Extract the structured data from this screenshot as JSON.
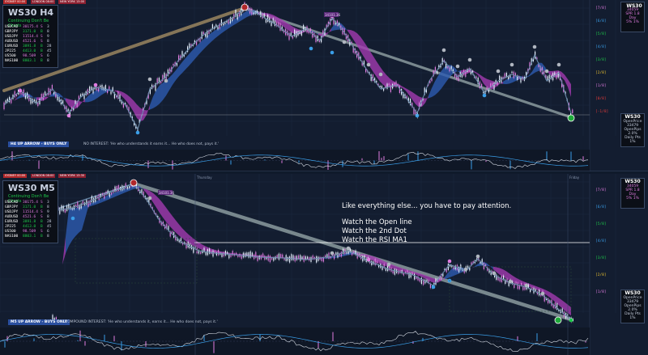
{
  "colors": {
    "background": "#131d30",
    "wave_line": "#6b8eaf",
    "trend_line_top": "#9a8560",
    "trend_line_bottom": "#8a9a9e",
    "ma_fill_blue": "#2d5bb0",
    "ma_fill_magenta": "#a23bb0",
    "dot_blue": "#3a9ee8",
    "dot_pink": "#e07ce0",
    "dot_gray": "#b0b6c0",
    "banner": "#2a4f9f",
    "open_line": "#ffffff"
  },
  "top_chart": {
    "title": "WS30 H4",
    "subtitle": "Continuing Don't Be Charts",
    "session_tabs": [
      "SYDNEY 00:00",
      "LONDON 08:00",
      "NEW YORK 13:00"
    ],
    "banner": "H4 UP ARROW - BUYS ONLY",
    "note": "NO INTEREST: 'He who understands it earns it... He who does not, pays it.'",
    "symbol_box": {
      "symbol": "WS30",
      "lines": [
        "34059",
        "SPR 1.8",
        "Day",
        "5% 1%"
      ]
    },
    "price_box": {
      "symbol": "WS30",
      "lines": [
        "OpenPrice",
        "33479",
        "OpenPips",
        "2.0%",
        "Daily Pts",
        "1%"
      ]
    },
    "levels": [
      "[7/8]",
      "[6/8]",
      "[5/8]",
      "[4/8]",
      "[3/8]",
      "[2/8]",
      "[1/8]",
      "[0/8]",
      "[-1/8]"
    ],
    "arrow_down_icon": "down-arrow-icon",
    "arrow_up_icon": "up-arrow-icon",
    "peak_label": "34101.36"
  },
  "bottom_chart": {
    "title": "WS30 M5",
    "subtitle": "Continuing Don't Be Charts",
    "session_tabs": [
      "SYDNEY 00:00",
      "LONDON 08:00",
      "NEW YORK 13:30"
    ],
    "banner": "M5 UP ARROW - BUYS ONLY",
    "note": "COMPOUND INTEREST: 'He who understands it, earns it... He who does not, pays it.'",
    "day_labels": [
      "Thursday",
      "Friday"
    ],
    "symbol_box": {
      "symbol": "WS30",
      "lines": [
        "34059",
        "SPR 1.8",
        "Day",
        "5% 1%"
      ]
    },
    "price_box": {
      "symbol": "WS30",
      "lines": [
        "OpenPrice",
        "33479",
        "OpenPips",
        "2.0%",
        "Daily Pts",
        "1%"
      ]
    },
    "levels": [
      "[7/8]",
      "[6/8]",
      "[5/8]",
      "[4/8]",
      "[3/8]",
      "[2/8]",
      "[1/8]"
    ],
    "peak_label": "34101.36",
    "annotations": [
      "Like everything else... you have to pay attention.",
      "Watch the Open line",
      "Watch the 2nd Dot",
      "Watch the RSI MA1"
    ]
  },
  "ticker_table": [
    {
      "sym": "USDCAD",
      "val": "30175.4",
      "sig": "S",
      "pct": "3"
    },
    {
      "sym": "GBPJPY",
      "val": "3171.0",
      "sig": "B",
      "pct": "8"
    },
    {
      "sym": "USDJPY",
      "val": "11514.4",
      "sig": "S",
      "pct": "9"
    },
    {
      "sym": "AUDUSD",
      "val": "4521.6",
      "sig": "S",
      "pct": "8"
    },
    {
      "sym": "EURUSD",
      "val": "3891.8",
      "sig": "B",
      "pct": "28"
    },
    {
      "sym": "JP225",
      "val": "4413.0",
      "sig": "B",
      "pct": "45"
    },
    {
      "sym": "US500",
      "val": "98.509",
      "sig": "S",
      "pct": "6"
    },
    {
      "sym": "NAS100",
      "val": "8803.1",
      "sig": "B",
      "pct": "8"
    }
  ]
}
